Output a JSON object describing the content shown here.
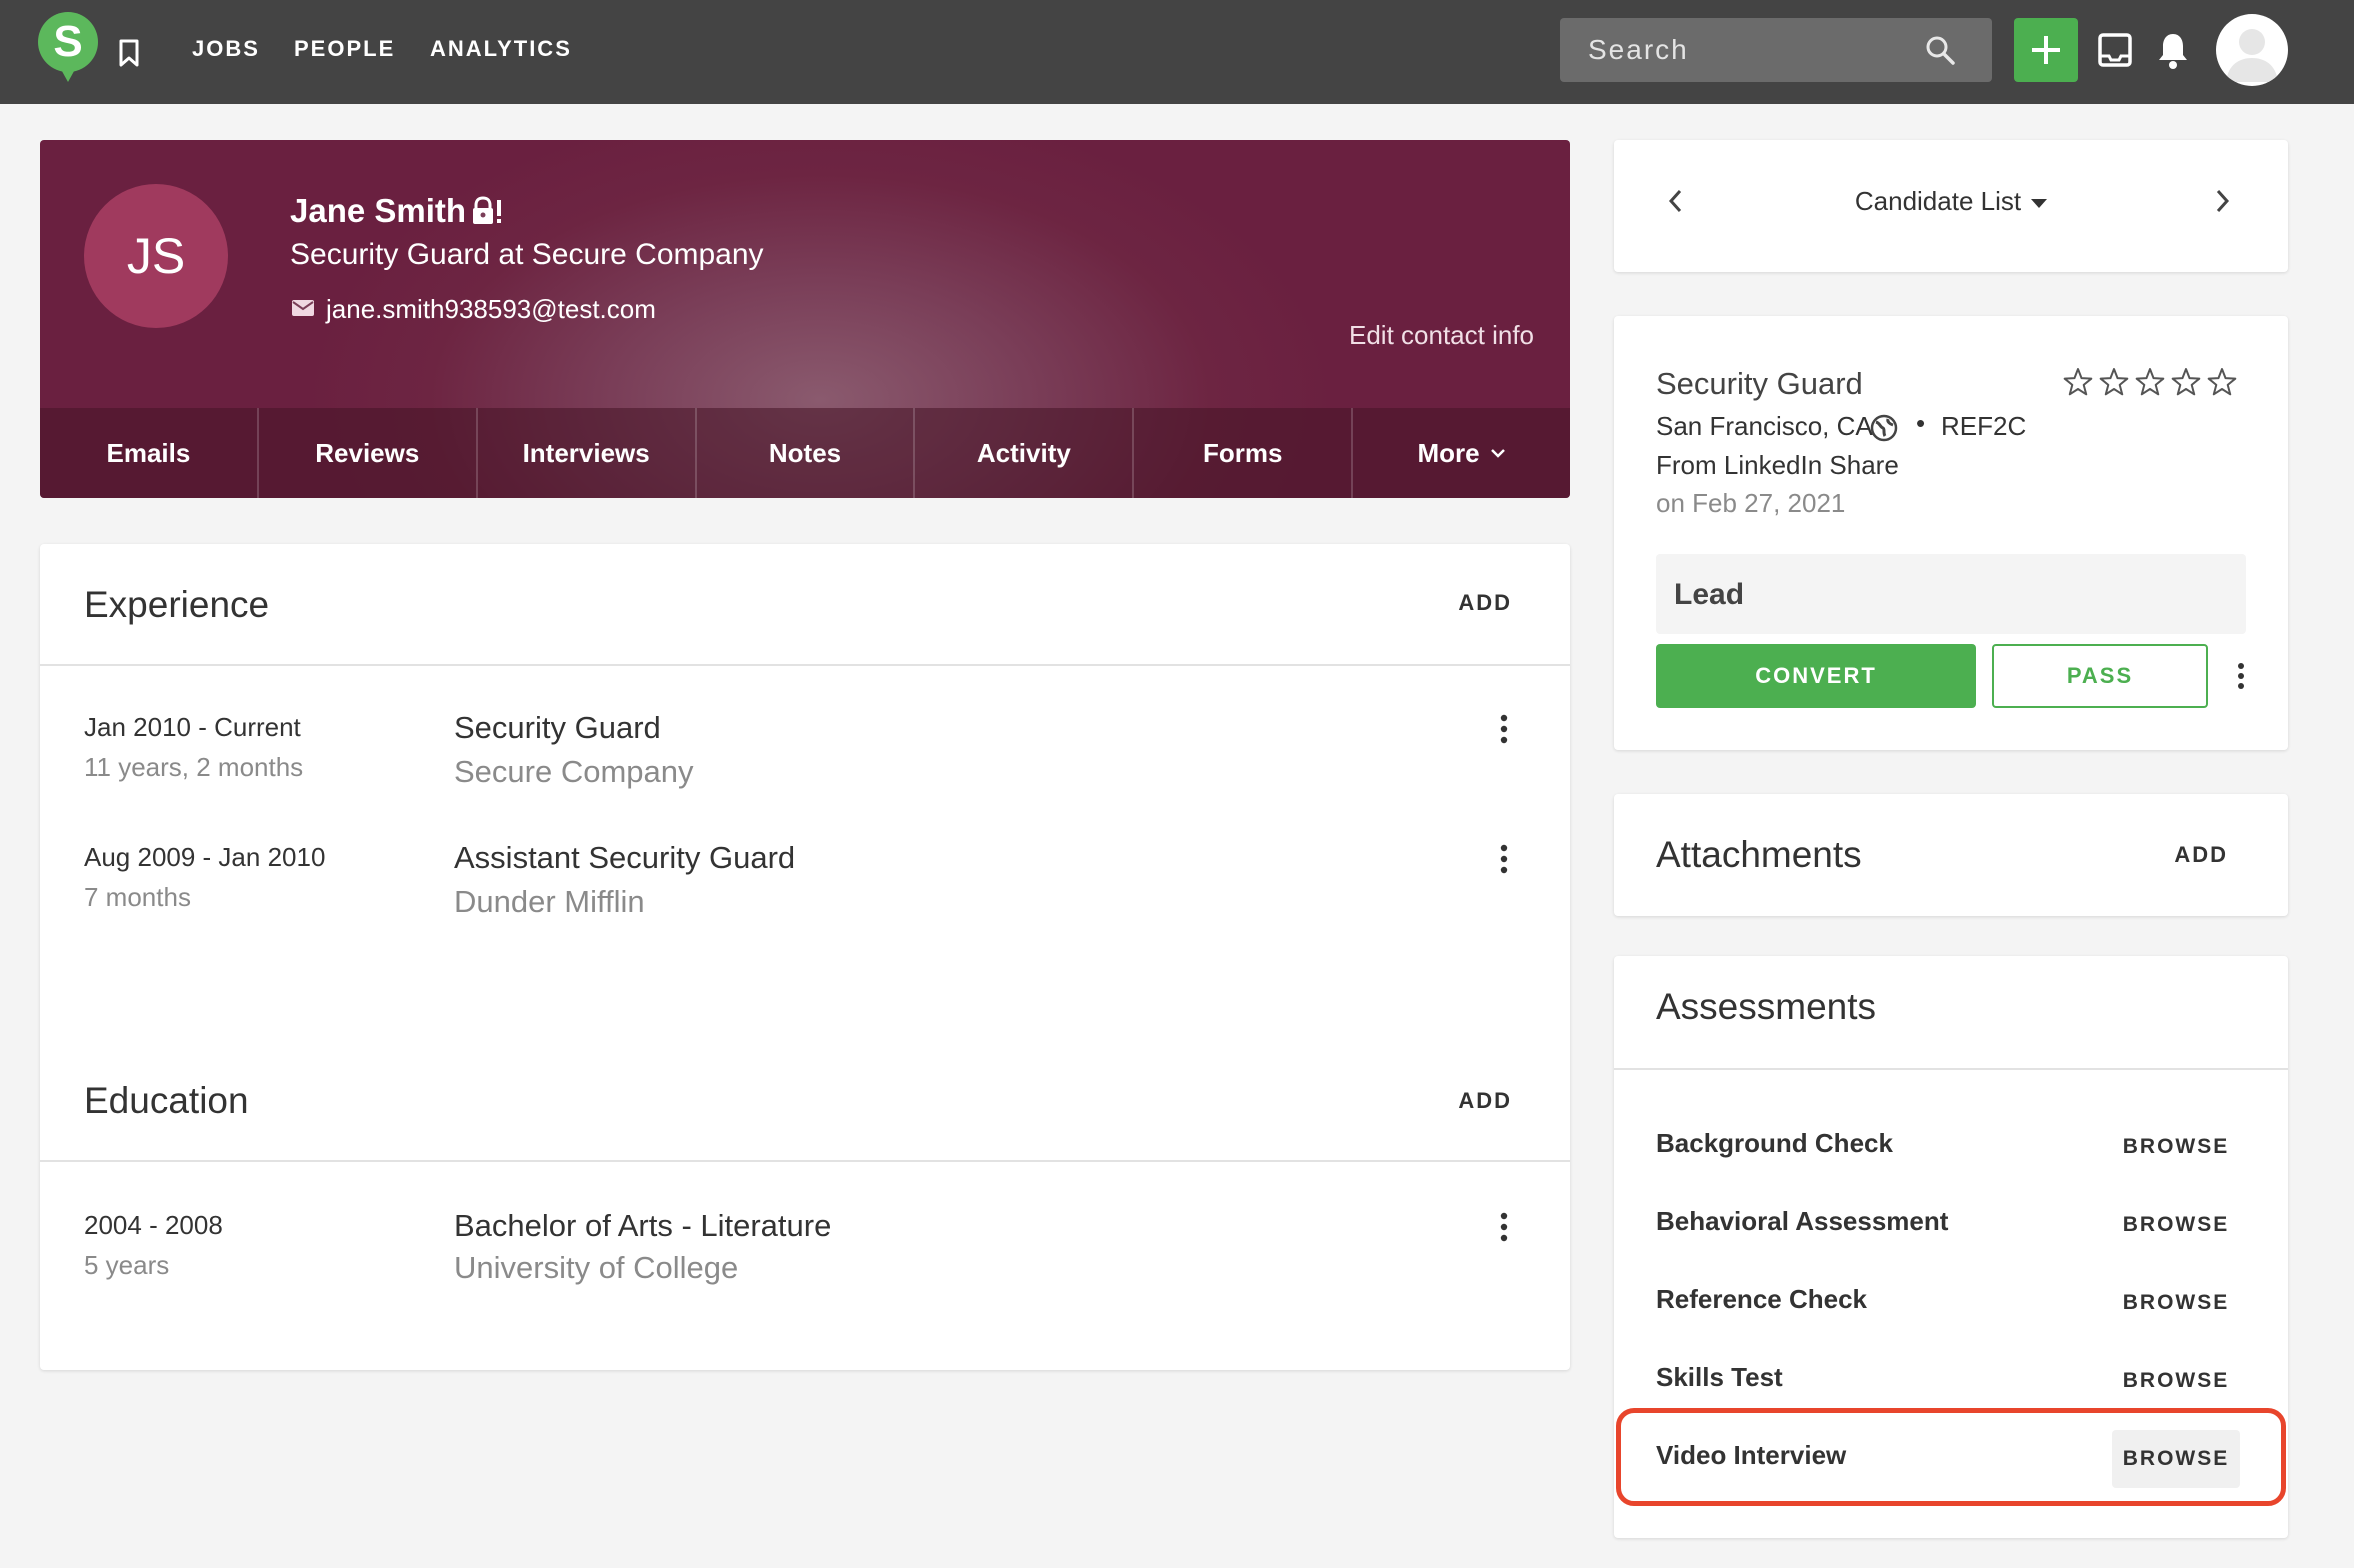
{
  "nav": {
    "logo_letter": "S",
    "links": [
      "JOBS",
      "PEOPLE",
      "ANALYTICS"
    ],
    "search_placeholder": "Search"
  },
  "candidate": {
    "initials": "JS",
    "name": "Jane Smith",
    "title": "Security Guard at Secure Company",
    "email": "jane.smith938593@test.com",
    "edit_contact_label": "Edit contact info",
    "tabs": [
      "Emails",
      "Reviews",
      "Interviews",
      "Notes",
      "Activity",
      "Forms",
      "More"
    ]
  },
  "experience": {
    "title": "Experience",
    "add_label": "ADD",
    "items": [
      {
        "dates": "Jan 2010 - Current",
        "duration": "11 years, 2 months",
        "role": "Security Guard",
        "org": "Secure Company"
      },
      {
        "dates": "Aug 2009 - Jan 2010",
        "duration": "7 months",
        "role": "Assistant Security Guard",
        "org": "Dunder Mifflin"
      }
    ]
  },
  "education": {
    "title": "Education",
    "add_label": "ADD",
    "items": [
      {
        "dates": "2004 - 2008",
        "duration": "5 years",
        "role": "Bachelor of Arts - Literature",
        "org": "University of College"
      }
    ]
  },
  "candidate_list": {
    "label": "Candidate List"
  },
  "job": {
    "title": "Security Guard",
    "location": "San Francisco, CA",
    "separator": "•",
    "ref": "REF2C",
    "source": "From LinkedIn Share",
    "date": "on Feb 27, 2021",
    "rating": 0,
    "rating_max": 5,
    "stage": "Lead",
    "convert_label": "CONVERT",
    "pass_label": "PASS"
  },
  "attachments": {
    "title": "Attachments",
    "add_label": "ADD"
  },
  "assessments": {
    "title": "Assessments",
    "browse_label": "BROWSE",
    "items": [
      "Background Check",
      "Behavioral Assessment",
      "Reference Check",
      "Skills Test",
      "Video Interview"
    ]
  },
  "colors": {
    "topbar": "#444444",
    "accent_green": "#4caf50",
    "header_maroon": "#6d2542",
    "highlight_red": "#e8452c"
  }
}
